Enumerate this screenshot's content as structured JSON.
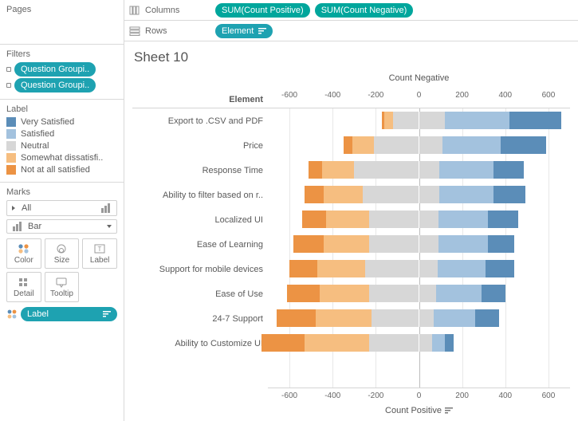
{
  "sidebar": {
    "pages_label": "Pages",
    "filters_label": "Filters",
    "filters": [
      {
        "label": "Question Groupi.."
      },
      {
        "label": "Question Groupi.."
      }
    ],
    "label_card_title": "Label",
    "legend": [
      {
        "label": "Very Satisfied",
        "color": "#5b8db8"
      },
      {
        "label": "Satisfied",
        "color": "#a3c2de"
      },
      {
        "label": "Neutral",
        "color": "#d7d7d7"
      },
      {
        "label": "Somewhat dissatisfi..",
        "color": "#f6be80"
      },
      {
        "label": "Not at all satisfied",
        "color": "#ec9344"
      }
    ],
    "marks_label": "Marks",
    "marks_all": "All",
    "marks_type": "Bar",
    "marks_buttons": [
      "Color",
      "Size",
      "Label",
      "Detail",
      "Tooltip"
    ],
    "marks_pill": "Label"
  },
  "shelves": {
    "columns_label": "Columns",
    "rows_label": "Rows",
    "column_pills": [
      "SUM(Count Positive)",
      "SUM(Count Negative)"
    ],
    "row_pills": [
      "Element"
    ]
  },
  "viz": {
    "sheet_title": "Sheet 10",
    "row_header": "Element",
    "top_axis_title": "Count Negative",
    "bottom_axis_title": "Count Positive",
    "ticks": [
      -600,
      -400,
      -200,
      0,
      200,
      400,
      600
    ]
  },
  "chart_data": {
    "type": "bar",
    "title": "Sheet 10",
    "xlabel": "Count Positive",
    "x2label": "Count Negative",
    "xlim": [
      -700,
      700
    ],
    "categories": [
      "Export to .CSV and PDF",
      "Price",
      "Response Time",
      "Ability to filter based on r..",
      "Localized UI",
      "Ease of Learning",
      "Support for mobile devices",
      "Ease of Use",
      "24-7 Support",
      "Ability to Customize UI"
    ],
    "series": [
      {
        "name": "Neutral (neg side)",
        "color": "#d7d7d7",
        "values": [
          -120,
          -210,
          -300,
          -260,
          -230,
          -230,
          -250,
          -230,
          -220,
          -230
        ]
      },
      {
        "name": "Somewhat dissatisfied",
        "color": "#f6be80",
        "values": [
          -40,
          -100,
          -150,
          -180,
          -200,
          -210,
          -220,
          -230,
          -260,
          -300
        ]
      },
      {
        "name": "Not at all satisfied",
        "color": "#ec9344",
        "values": [
          -10,
          -40,
          -60,
          -90,
          -110,
          -140,
          -130,
          -150,
          -180,
          -200
        ]
      },
      {
        "name": "Neutral (pos side)",
        "color": "#d7d7d7",
        "values": [
          120,
          110,
          95,
          95,
          90,
          90,
          85,
          80,
          70,
          60
        ]
      },
      {
        "name": "Satisfied",
        "color": "#a3c2de",
        "values": [
          300,
          270,
          250,
          250,
          230,
          230,
          225,
          210,
          190,
          60
        ]
      },
      {
        "name": "Very Satisfied",
        "color": "#5b8db8",
        "values": [
          240,
          210,
          140,
          150,
          140,
          120,
          130,
          110,
          110,
          40
        ]
      }
    ]
  }
}
